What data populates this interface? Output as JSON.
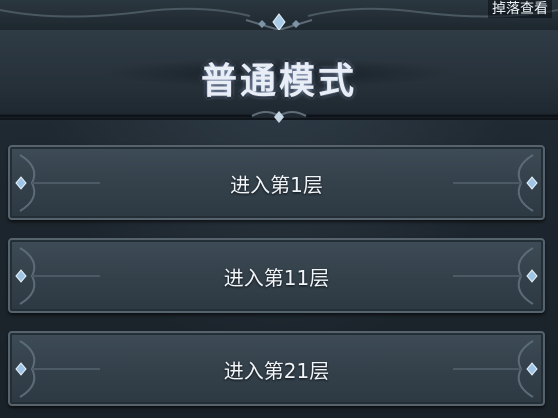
{
  "topbar": {
    "drop_view_label": "掉落查看"
  },
  "header": {
    "mode_title": "普通模式"
  },
  "floors": [
    {
      "label": "进入第1层"
    },
    {
      "label": "进入第11层"
    },
    {
      "label": "进入第21层"
    }
  ],
  "colors": {
    "background": "#1f2830",
    "button_fill": "#34414b",
    "button_border": "#56636d",
    "gem_accent": "#9fc4e4",
    "title_text": "#e9eef6"
  },
  "icons": [
    "diamond-gem-icon",
    "vine-ornament-icon"
  ]
}
